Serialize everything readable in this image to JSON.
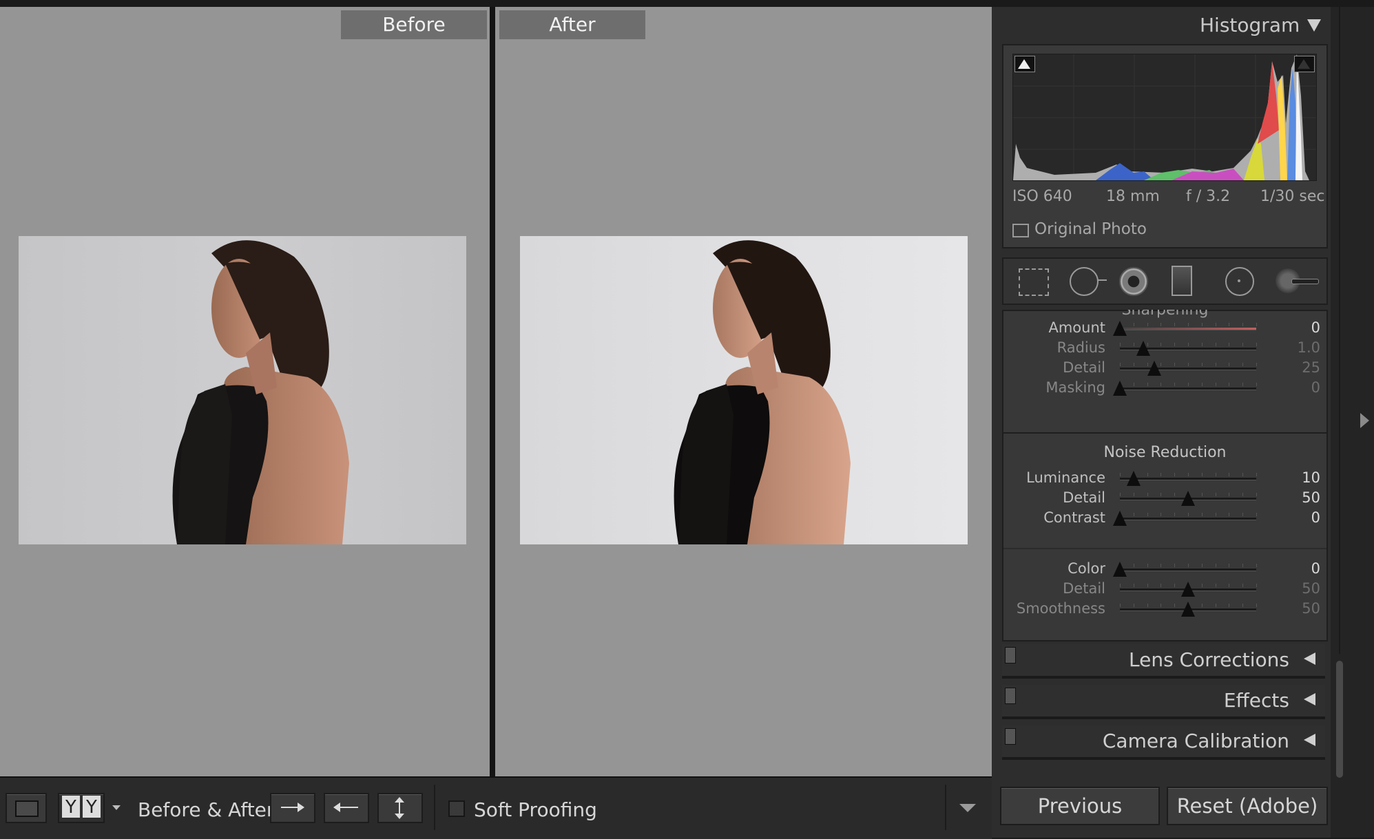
{
  "compare": {
    "before_label": "Before",
    "after_label": "After"
  },
  "toolbar": {
    "view_icon": "loupe-view-icon",
    "yy_label_left": "Y",
    "yy_label_right": "Y",
    "before_after_label": "Before & After :",
    "soft_proofing_label": "Soft Proofing",
    "soft_proofing_checked": false
  },
  "histogram": {
    "title": "Histogram",
    "exif": {
      "iso": "ISO 640",
      "focal": "18 mm",
      "aperture": "f / 3.2",
      "shutter": "1/30 sec"
    },
    "original_photo_label": "Original Photo",
    "original_photo_checked": false
  },
  "tools": [
    {
      "name": "crop-overlay-icon"
    },
    {
      "name": "spot-removal-icon"
    },
    {
      "name": "red-eye-icon"
    },
    {
      "name": "graduated-filter-icon"
    },
    {
      "name": "radial-filter-icon"
    },
    {
      "name": "adjustment-brush-icon"
    }
  ],
  "sharpening": {
    "title": "Sharpening",
    "rows": [
      {
        "label": "Amount",
        "value": "0",
        "level": 0.0,
        "active": true
      },
      {
        "label": "Radius",
        "value": "1.0",
        "level": 0.17,
        "active": false
      },
      {
        "label": "Detail",
        "value": "25",
        "level": 0.25,
        "active": false
      },
      {
        "label": "Masking",
        "value": "0",
        "level": 0.0,
        "active": false
      }
    ]
  },
  "noise": {
    "title": "Noise Reduction",
    "rows": [
      {
        "label": "Luminance",
        "value": "10",
        "level": 0.1,
        "active": true
      },
      {
        "label": "Detail",
        "value": "50",
        "level": 0.5,
        "active": true
      },
      {
        "label": "Contrast",
        "value": "0",
        "level": 0.0,
        "active": true
      }
    ],
    "color_rows": [
      {
        "label": "Color",
        "value": "0",
        "level": 0.0,
        "active": true
      },
      {
        "label": "Detail",
        "value": "50",
        "level": 0.5,
        "active": false
      },
      {
        "label": "Smoothness",
        "value": "50",
        "level": 0.5,
        "active": false
      }
    ]
  },
  "collapsed_panels": [
    {
      "label": "Lens Corrections"
    },
    {
      "label": "Effects"
    },
    {
      "label": "Camera Calibration"
    }
  ],
  "buttons": {
    "previous": "Previous",
    "reset": "Reset (Adobe)"
  }
}
